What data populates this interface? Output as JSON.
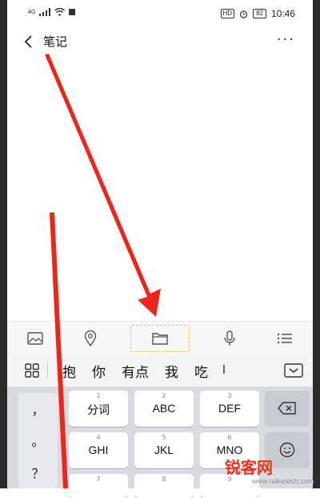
{
  "status_bar": {
    "network": "4G",
    "hd": "HD",
    "battery": "82",
    "time": "10:46"
  },
  "header": {
    "back_icon": "chevron-left-icon",
    "title": "笔记",
    "more": "···"
  },
  "toolbar": {
    "items": [
      "image-icon",
      "location-pin-icon",
      "folder-icon",
      "microphone-icon",
      "list-icon"
    ],
    "highlighted": "folder-icon"
  },
  "ime": {
    "candidates": [
      "抱",
      "你",
      "有点",
      "我",
      "吃",
      "l"
    ],
    "punctuation": [
      "，",
      "。",
      "？"
    ],
    "keys_row1": [
      {
        "num": "1",
        "label": "分词"
      },
      {
        "num": "2",
        "label": "ABC"
      },
      {
        "num": "3",
        "label": "DEF"
      }
    ],
    "keys_row2": [
      {
        "num": "4",
        "label": "GHI"
      },
      {
        "num": "5",
        "label": "JKL"
      },
      {
        "num": "6",
        "label": "MNO"
      }
    ],
    "keys_row3": [
      {
        "num": "7",
        "label": ""
      },
      {
        "num": "8",
        "label": ""
      },
      {
        "num": "9",
        "label": ""
      }
    ]
  },
  "watermark": {
    "brand": "锐客网",
    "url": "www.ruiketech.com"
  },
  "colors": {
    "arrow": "#f0241b",
    "highlight_border": "#f0b74d",
    "keyboard_bg": "#d8dbe0"
  }
}
